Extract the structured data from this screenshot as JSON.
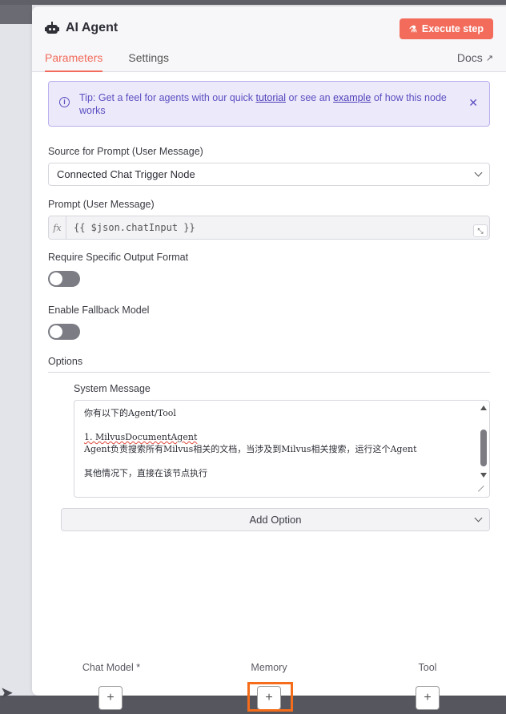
{
  "header": {
    "title": "AI Agent",
    "execute_label": "Execute step",
    "tabs": [
      {
        "label": "Parameters",
        "active": true
      },
      {
        "label": "Settings",
        "active": false
      }
    ],
    "docs_label": "Docs"
  },
  "tip": {
    "prefix": "Tip: Get a feel for agents with our quick ",
    "link1": "tutorial",
    "middle": " or see an ",
    "link2": "example",
    "suffix": " of how this node works"
  },
  "source_prompt": {
    "label": "Source for Prompt (User Message)",
    "value": "Connected Chat Trigger Node"
  },
  "prompt": {
    "label": "Prompt (User Message)",
    "fx": "fx",
    "value": "{{ $json.chatInput }}"
  },
  "output_format": {
    "label": "Require Specific Output Format",
    "enabled": false
  },
  "fallback": {
    "label": "Enable Fallback Model",
    "enabled": false
  },
  "options": {
    "label": "Options",
    "system_message_label": "System Message",
    "system_message_lines": [
      "你有以下的Agent/Tool",
      "",
      "1. MilvusDocumentAgent",
      "Agent负责搜索所有Milvus相关的文档，当涉及到Milvus相关搜索，运行这个Agent",
      "",
      "其他情况下，直接在该节点执行"
    ],
    "add_option_label": "Add Option"
  },
  "connectors": {
    "chat_model": "Chat Model *",
    "memory": "Memory",
    "tool": "Tool",
    "plus": "+"
  }
}
